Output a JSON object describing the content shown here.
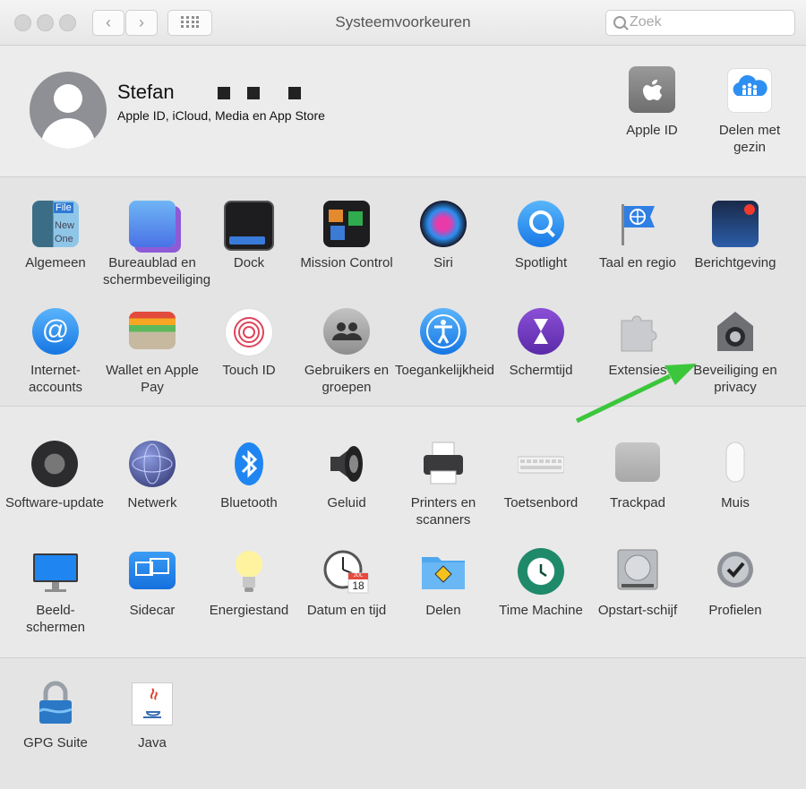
{
  "window": {
    "title": "Systeemvoorkeuren",
    "search_placeholder": "Zoek"
  },
  "account": {
    "name": "Stefan",
    "subtitle": "Apple ID, iCloud, Media en App Store",
    "apple_id_label": "Apple ID",
    "family_label": "Delen met gezin"
  },
  "row1": [
    {
      "label": "Algemeen",
      "icon": "general-icon"
    },
    {
      "label": "Bureaublad en schermbeveiliging",
      "icon": "desktop-screensaver-icon"
    },
    {
      "label": "Dock",
      "icon": "dock-icon"
    },
    {
      "label": "Mission Control",
      "icon": "mission-control-icon"
    },
    {
      "label": "Siri",
      "icon": "siri-icon"
    },
    {
      "label": "Spotlight",
      "icon": "spotlight-icon"
    },
    {
      "label": "Taal en regio",
      "icon": "language-region-icon"
    },
    {
      "label": "Berichtgeving",
      "icon": "notifications-icon"
    }
  ],
  "row2": [
    {
      "label": "Internet-accounts",
      "icon": "internet-accounts-icon"
    },
    {
      "label": "Wallet en Apple Pay",
      "icon": "wallet-icon"
    },
    {
      "label": "Touch ID",
      "icon": "touch-id-icon"
    },
    {
      "label": "Gebruikers en groepen",
      "icon": "users-groups-icon"
    },
    {
      "label": "Toegankelijkheid",
      "icon": "accessibility-icon"
    },
    {
      "label": "Schermtijd",
      "icon": "screen-time-icon"
    },
    {
      "label": "Extensies",
      "icon": "extensions-icon"
    },
    {
      "label": "Beveiliging en privacy",
      "icon": "security-privacy-icon"
    }
  ],
  "row3": [
    {
      "label": "Software-update",
      "icon": "software-update-icon"
    },
    {
      "label": "Netwerk",
      "icon": "network-icon"
    },
    {
      "label": "Bluetooth",
      "icon": "bluetooth-icon"
    },
    {
      "label": "Geluid",
      "icon": "sound-icon"
    },
    {
      "label": "Printers en scanners",
      "icon": "printers-icon"
    },
    {
      "label": "Toetsenbord",
      "icon": "keyboard-icon"
    },
    {
      "label": "Trackpad",
      "icon": "trackpad-icon"
    },
    {
      "label": "Muis",
      "icon": "mouse-icon"
    }
  ],
  "row4": [
    {
      "label": "Beeld-schermen",
      "icon": "displays-icon"
    },
    {
      "label": "Sidecar",
      "icon": "sidecar-icon"
    },
    {
      "label": "Energiestand",
      "icon": "energy-saver-icon"
    },
    {
      "label": "Datum en tijd",
      "icon": "date-time-icon"
    },
    {
      "label": "Delen",
      "icon": "sharing-icon"
    },
    {
      "label": "Time Machine",
      "icon": "time-machine-icon"
    },
    {
      "label": "Opstart-schijf",
      "icon": "startup-disk-icon"
    },
    {
      "label": "Profielen",
      "icon": "profiles-icon"
    }
  ],
  "row5": [
    {
      "label": "GPG Suite",
      "icon": "gpg-suite-icon"
    },
    {
      "label": "Java",
      "icon": "java-icon"
    }
  ],
  "date_icon_month": "JUL",
  "date_icon_day": "18",
  "general_icon_text_1": "File",
  "general_icon_text_2": "New",
  "general_icon_text_3": "One",
  "colors": {
    "annotation_arrow": "#3cc63c",
    "accent_blue": "#1f86f1"
  }
}
